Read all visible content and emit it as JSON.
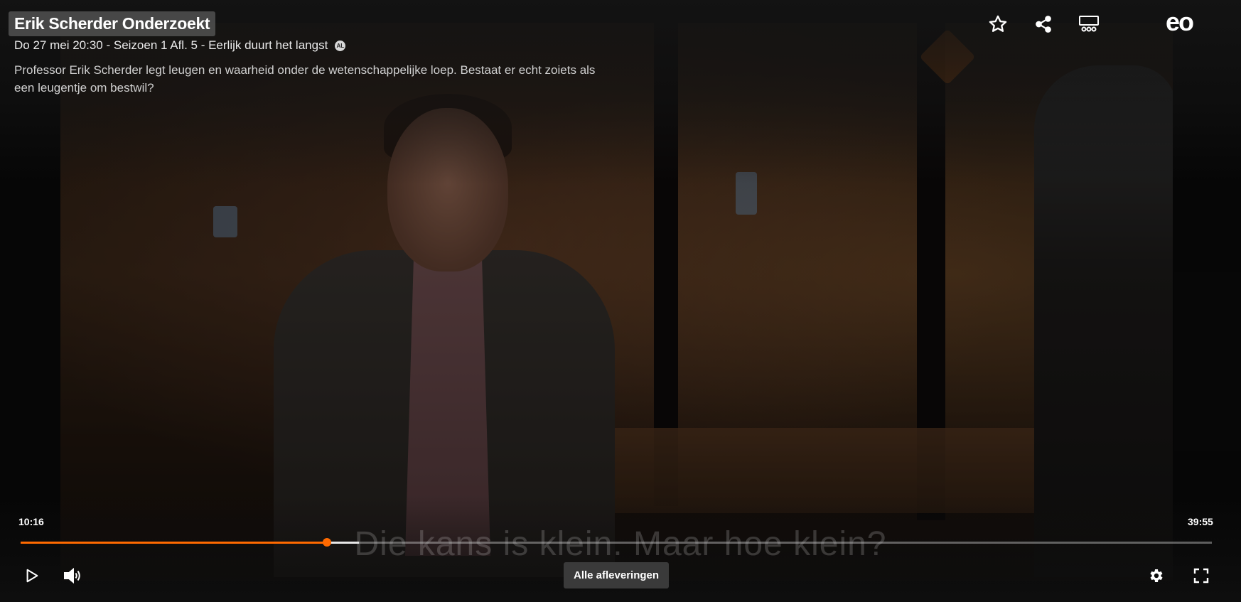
{
  "header": {
    "title": "Erik Scherder Onderzoekt",
    "meta": "Do 27 mei 20:30 - Seizoen 1 Afl. 5 - Eerlijk duurt het langst",
    "rating_badge": "AL",
    "description": "Professor Erik Scherder legt leugen en waarheid onder de wetenschappelijke loep. Bestaat er echt zoiets als een leugentje om bestwil?",
    "brand": "eo"
  },
  "top_icons": [
    "star-icon",
    "share-icon",
    "episodes-icon"
  ],
  "video": {
    "subtitle": "Die kans is klein. Maar hoe klein?"
  },
  "player": {
    "current_time": "10:16",
    "duration": "39:55",
    "progress": 0.257,
    "buffered": 0.284,
    "all_episodes_label": "Alle afleveringen"
  },
  "colors": {
    "accent": "#ff6a00",
    "background": "#0b0b0b"
  }
}
